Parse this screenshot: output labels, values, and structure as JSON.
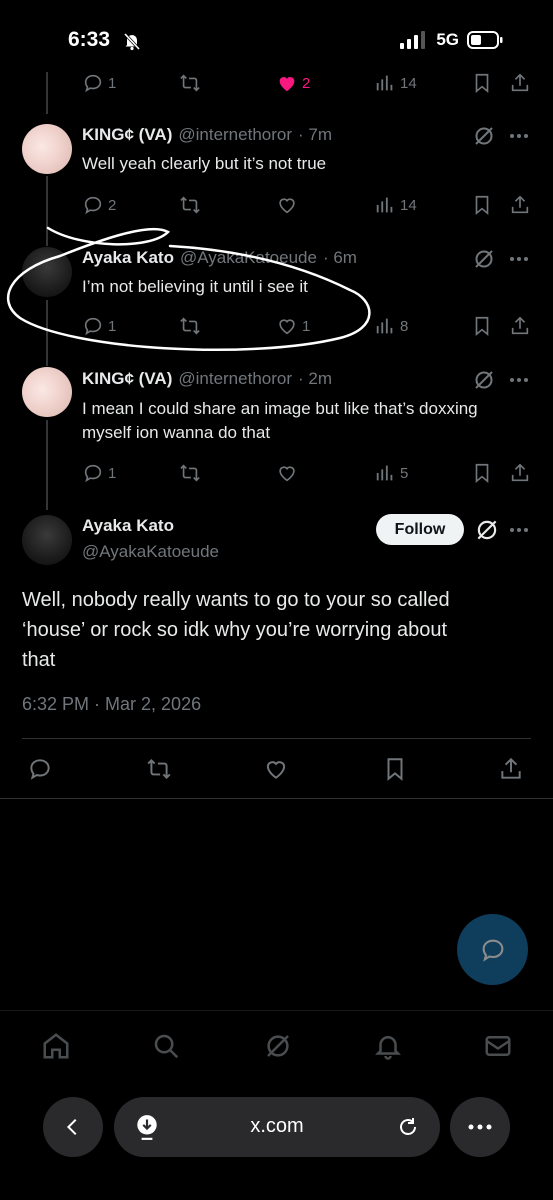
{
  "status_bar": {
    "time": "6:33",
    "network": "5G"
  },
  "top_partial_actions": {
    "replies": "1",
    "likes": "2",
    "views": "14"
  },
  "replies": [
    {
      "name": "KING¢ (VA)",
      "handle": "@internethoror",
      "time": "· 7m",
      "text_lines": [
        "Well yeah clearly but it’s not true"
      ],
      "reply_count": "2",
      "retweet_count": "",
      "like_count": "",
      "views": "14"
    },
    {
      "name": "Ayaka Kato",
      "handle": "@AyakaKatoeude",
      "time": "· 6m",
      "text_lines": [
        "I’m not believing it until i see it"
      ],
      "reply_count": "1",
      "retweet_count": "",
      "like_count": "1",
      "views": "8"
    },
    {
      "name": "KING¢ (VA)",
      "handle": "@internethoror",
      "time": "· 2m",
      "text_lines": [
        "I mean I could share an image but like that’s doxxing",
        "myself ion wanna do that"
      ],
      "reply_count": "1",
      "retweet_count": "",
      "like_count": "",
      "views": "5"
    }
  ],
  "main_post": {
    "name": "Ayaka Kato",
    "handle": "@AyakaKatoeude",
    "follow_label": "Follow",
    "text_lines": [
      "Well, nobody really wants to go to your so called",
      "‘house’ or rock so idk why you’re worrying about",
      "that"
    ],
    "timestamp": "6:32 PM · Mar 2, 2026"
  },
  "browser": {
    "url": "x.com"
  },
  "colors": {
    "like_active": "#f91880",
    "accent": "#1d9bf0",
    "muted": "#71767b"
  },
  "icons": [
    "reply-icon",
    "retweet-icon",
    "like-icon",
    "views-icon",
    "bookmark-icon",
    "share-icon",
    "grok-icon",
    "more-icon",
    "home-icon",
    "search-icon",
    "bell-icon",
    "mail-icon",
    "compose-icon"
  ]
}
